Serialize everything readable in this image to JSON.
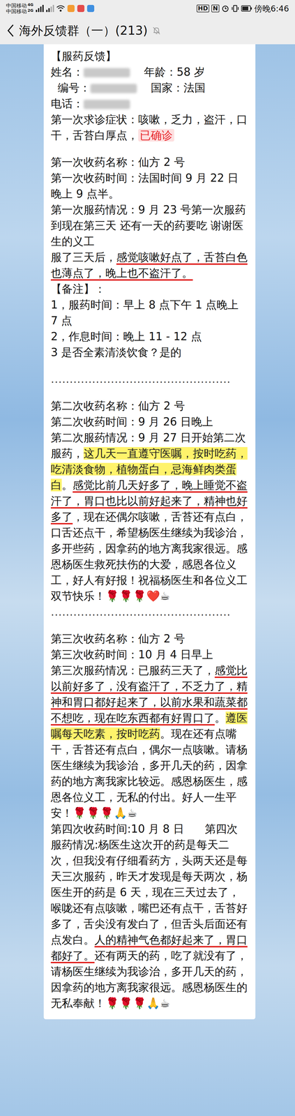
{
  "status_bar": {
    "lines": [
      {
        "carrier": "中国移动",
        "net": "4G"
      },
      {
        "carrier": "中国移动",
        "net": "2G"
      }
    ],
    "indicators": [
      "HD",
      "N"
    ],
    "time": "傍晚6:46"
  },
  "header": {
    "title": "海外反馈群（一）(213)",
    "muted": true
  },
  "message": {
    "paragraphs": [
      {
        "kind": "text",
        "segments": [
          {
            "kind": "plain",
            "text": "【服药反馈】"
          }
        ]
      },
      {
        "kind": "text",
        "segments": [
          {
            "kind": "plain",
            "text": "姓名："
          },
          {
            "kind": "blur",
            "text": ""
          },
          {
            "kind": "plain",
            "text": "    年龄：58 岁"
          }
        ]
      },
      {
        "kind": "text",
        "segments": [
          {
            "kind": "plain",
            "text": "  编号："
          },
          {
            "kind": "blur",
            "text": ""
          },
          {
            "kind": "plain",
            "text": "    国家：法国"
          }
        ]
      },
      {
        "kind": "text",
        "segments": [
          {
            "kind": "plain",
            "text": "电话："
          },
          {
            "kind": "blur",
            "text": ""
          }
        ]
      },
      {
        "kind": "text",
        "segments": [
          {
            "kind": "plain",
            "text": "第一次求诊症状：咳嗽，乏力，盗汗，口干，舌苔白厚点，"
          },
          {
            "kind": "tag",
            "text": "已确诊"
          }
        ]
      },
      {
        "kind": "gap",
        "segments": []
      },
      {
        "kind": "text",
        "segments": [
          {
            "kind": "plain",
            "text": "第一次收药名称：仙方 2 号"
          }
        ]
      },
      {
        "kind": "text",
        "segments": [
          {
            "kind": "plain",
            "text": "第一次收药时间：法国时间 9 月 22 日晚上 9 点半。"
          }
        ]
      },
      {
        "kind": "text",
        "segments": [
          {
            "kind": "plain",
            "text": "第一次服药情况：9 月 23 号第一次服药 到现在第三天 还有一天的药要吃 谢谢医生的义工"
          }
        ]
      },
      {
        "kind": "text",
        "segments": [
          {
            "kind": "plain",
            "text": "服了三天后，"
          },
          {
            "kind": "underline",
            "text": "感觉咳嗽好点了，舌苔白色也薄点了，晚上也不盗汗了。"
          }
        ]
      },
      {
        "kind": "text",
        "segments": [
          {
            "kind": "plain",
            "text": "【备注】："
          }
        ]
      },
      {
        "kind": "text",
        "segments": [
          {
            "kind": "plain",
            "text": "1，服药时间：早上 8 点下午 1 点晚上 7 点"
          }
        ]
      },
      {
        "kind": "text",
        "segments": [
          {
            "kind": "plain",
            "text": "2，作息时间：晚上 11 - 12 点"
          }
        ]
      },
      {
        "kind": "text",
        "segments": [
          {
            "kind": "plain",
            "text": "3 是否全素清淡饮食？是的"
          }
        ]
      },
      {
        "kind": "gap",
        "segments": []
      },
      {
        "kind": "dots",
        "segments": [
          {
            "kind": "plain",
            "text": "................................................"
          }
        ]
      },
      {
        "kind": "gap",
        "segments": []
      },
      {
        "kind": "text",
        "segments": [
          {
            "kind": "plain",
            "text": "第二次收药名称：仙方 2 号"
          }
        ]
      },
      {
        "kind": "text",
        "segments": [
          {
            "kind": "plain",
            "text": "第二次收药时间：9 月 26 日晚上"
          }
        ]
      },
      {
        "kind": "text",
        "segments": [
          {
            "kind": "plain",
            "text": "第二次服药情况：9 月 27 日开始第二次服药，"
          },
          {
            "kind": "highlight",
            "text": "这几天一直遵守医嘱，按时吃药，吃清淡食物，植物蛋白，忌海鲜肉类蛋白"
          },
          {
            "kind": "plain",
            "text": "。"
          },
          {
            "kind": "underline",
            "text": "感觉比前几天好多了，晚上睡觉不盗汗了，胃口也比以前好起来了，精神也好多了"
          },
          {
            "kind": "plain",
            "text": "，现在还偶尔咳嗽，舌苔还有点白，口舌还点干，希望杨医生继续为我诊治，多开些药，因拿药的地方离我家很远。感恩杨医生救死扶伤的大爱，感恩各位义工，好人有好报！祝福杨医生和各位义工双节快乐！🌹🌹🌹❤️☕"
          }
        ]
      },
      {
        "kind": "dots",
        "segments": [
          {
            "kind": "plain",
            "text": "................................................"
          }
        ]
      },
      {
        "kind": "gap",
        "segments": []
      },
      {
        "kind": "text",
        "segments": [
          {
            "kind": "plain",
            "text": "第三次收药名称：仙方 2 号"
          }
        ]
      },
      {
        "kind": "text",
        "segments": [
          {
            "kind": "plain",
            "text": "第三次收药时间：10 月 4 日早上"
          }
        ]
      },
      {
        "kind": "text",
        "segments": [
          {
            "kind": "plain",
            "text": "第三次服药情况：已服药三天了，"
          },
          {
            "kind": "underline",
            "text": "感觉比以前好多了，没有盗汗了，不乏力了，精神和胃口都好起来了，以前水果和蔬菜都不想吃，现在吃东西都有好胃口了"
          },
          {
            "kind": "plain",
            "text": "。"
          },
          {
            "kind": "highlight",
            "text": "遵医嘱每天吃素，按时吃药"
          },
          {
            "kind": "plain",
            "text": "。现在还有点嘴干，舌苔还有点白，偶尔一点咳嗽。请杨医生继续为我诊治，多开几天的药，因拿药的地方离我家比较远。感恩杨医生，感恩各位义工，无私的付出。好人一生平安！🌹🌹🌹🙏☕"
          }
        ]
      },
      {
        "kind": "text",
        "segments": [
          {
            "kind": "plain",
            "text": "第四次收药时间:10 月 8 日      第四次服药情况:杨医生这次开的药是每天二次，但我没有仔细看药方，头两天还是每天三次服药，昨天才发现是每天两次，杨医生开的药是 6 天，现在三天过去了，喉咙还有点咳嗽，嘴巴还有点干，舌苔好多了，舌尖没有发白了，但舌头后面还有点发白。"
          },
          {
            "kind": "underline",
            "text": "人的精神气色都好起来了，胃口都好了。"
          },
          {
            "kind": "plain",
            "text": "还有两天的药，吃了就没有了，请杨医生继续为我诊治，多开几天的药，因拿药的地方离我家很远。感恩杨医生的无私奉献！🌹🌹🌹🙏☕"
          }
        ]
      }
    ]
  }
}
